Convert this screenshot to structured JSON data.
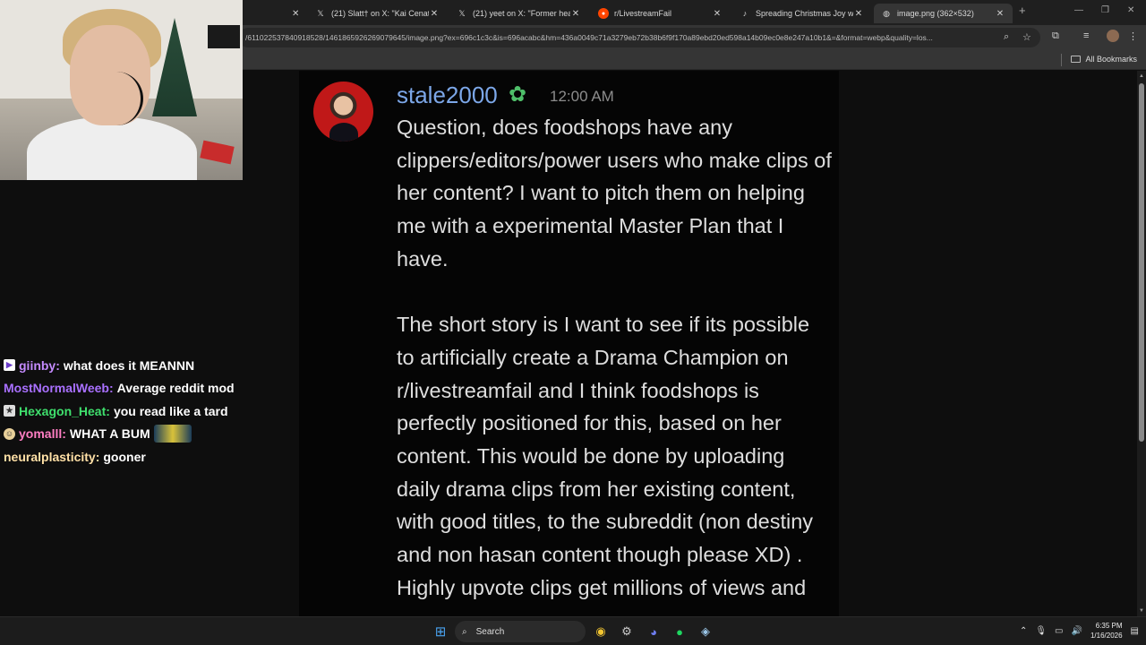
{
  "browser": {
    "tabs": [
      {
        "icon": "x-icon",
        "title": "(21) Slatt† on X: \"Kai Cenat ke",
        "active": false
      },
      {
        "icon": "x-icon",
        "title": "(21) yeet on X: \"Former head L",
        "active": false
      },
      {
        "icon": "reddit-icon",
        "title": "r/LivestreamFail",
        "active": false
      },
      {
        "icon": "tiktok-icon",
        "title": "Spreading Christmas Joy with S",
        "active": false
      },
      {
        "icon": "globe-icon",
        "title": "image.png (362×532)",
        "active": true
      }
    ],
    "url": "/611022537840918528/1461865926269079645/image.png?ex=696c1c3c&is=696acabc&hm=436a0049c71a3279eb72b38b6f9f170a89ebd20ed598a14b09ec0e8e247a10b1&=&format=webp&quality=los...",
    "bookmarks_label": "All Bookmarks"
  },
  "post": {
    "username": "stale2000",
    "timestamp": "12:00 AM",
    "paragraphs": [
      "Question, does foodshops have any clippers/editors/power users who make clips of her content?  I want to pitch them on helping me with a experimental Master Plan that I have.",
      "The short story is I want to see if its possible to artificially create a Drama Champion on r/livestreamfail and I think foodshops is perfectly positioned for this, based on her content.  This would be done by uploading daily drama clips from her existing content, with good titles, to the subreddit (non destiny and non hasan content though please XD) .  Highly upvote clips get millions of views and"
    ]
  },
  "chat": [
    {
      "user": "giinby",
      "message": "what does it MEANNN",
      "color": "#c58bff",
      "badge": "video-badge-icon"
    },
    {
      "user": "MostNormalWeeb",
      "message": "Average reddit mod",
      "color": "#a970ff",
      "badge": ""
    },
    {
      "user": "Hexagon_Heat",
      "message": "you read like a tard",
      "color": "#3fe06d",
      "badge": "star-badge-icon"
    },
    {
      "user": "yomalll",
      "message": "WHAT A BUM",
      "color": "#ff7ec3",
      "badge": "face-badge-icon",
      "emote": true
    },
    {
      "user": "neuralplasticity",
      "message": "gooner",
      "color": "#ffe0a6",
      "badge": ""
    }
  ],
  "taskbar": {
    "search_label": "Search",
    "time": "6:35 PM",
    "date": "1/16/2026"
  }
}
